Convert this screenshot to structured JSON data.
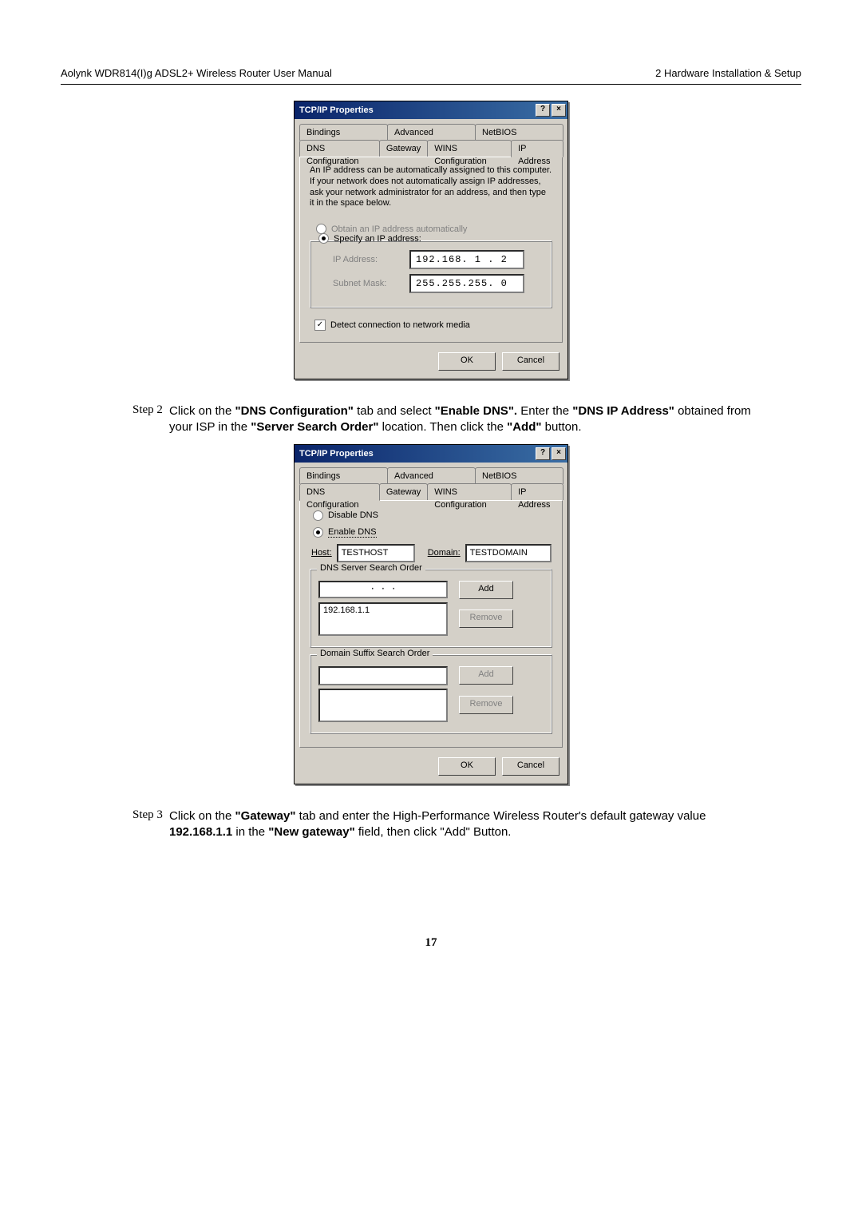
{
  "header": {
    "left": "Aolynk WDR814(I)g ADSL2+ Wireless Router User Manual",
    "right": "2 Hardware Installation & Setup"
  },
  "dialog1": {
    "title": "TCP/IP Properties",
    "help": "?",
    "close": "×",
    "tabs": {
      "bindings": "Bindings",
      "advanced": "Advanced",
      "netbios": "NetBIOS",
      "dnscfg": "DNS Configuration",
      "gateway": "Gateway",
      "winscfg": "WINS Configuration",
      "ipaddr": "IP Address"
    },
    "desc": "An IP address can be automatically assigned to this computer. If your network does not automatically assign IP addresses, ask your network administrator for an address, and then type it in the space below.",
    "radio_auto": "Obtain an IP address automatically",
    "radio_spec": "Specify an IP address:",
    "ip_label": "IP Address:",
    "ip_value": "192.168. 1 . 2",
    "mask_label": "Subnet Mask:",
    "mask_value": "255.255.255. 0",
    "detect": "Detect connection to network media",
    "ok": "OK",
    "cancel": "Cancel"
  },
  "step2": {
    "tag": "Step 2",
    "t1": "Click on the ",
    "b1": "\"DNS Configuration\"",
    "t2": " tab and select ",
    "b2": "\"Enable DNS\".",
    "t3": " Enter the ",
    "b3": "\"DNS IP Address\"",
    "t4": " obtained from your ISP in the ",
    "b4": "\"Server Search Order\"",
    "t5": " location. Then click the ",
    "b5": "\"Add\"",
    "t6": " button."
  },
  "dialog2": {
    "title": "TCP/IP Properties",
    "help": "?",
    "close": "×",
    "tabs": {
      "bindings": "Bindings",
      "advanced": "Advanced",
      "netbios": "NetBIOS",
      "dnscfg": "DNS Configuration",
      "gateway": "Gateway",
      "winscfg": "WINS Configuration",
      "ipaddr": "IP Address"
    },
    "radio_disable": "Disable DNS",
    "radio_enable": "Enable DNS",
    "host_lbl": "Host:",
    "host_val": "TESTHOST",
    "domain_lbl": "Domain:",
    "domain_val": "TESTDOMAIN",
    "dns_order": "DNS Server Search Order",
    "ip_dots": "·   ·   ·",
    "add": "Add",
    "dns_entry": "192.168.1.1",
    "remove": "Remove",
    "suffix_order": "Domain Suffix Search Order",
    "add2": "Add",
    "remove2": "Remove",
    "ok": "OK",
    "cancel": "Cancel"
  },
  "step3": {
    "tag": "Step 3",
    "t1": "Click on the ",
    "b1": "\"Gateway\"",
    "t2": " tab and enter the High-Performance Wireless Router's default gateway value ",
    "b2": "192.168.1.1",
    "t3": " in the ",
    "b3": "\"New gateway\"",
    "t4": " field, then click \"Add\" Button."
  },
  "pagenum": "17"
}
